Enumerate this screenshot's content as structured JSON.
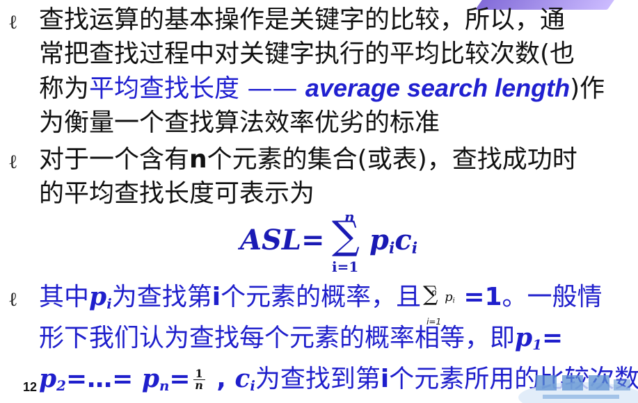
{
  "bullet_glyph": "ℓ",
  "bullet1": {
    "line1": "查找运算的基本操作是关键字的比较，所以，通",
    "line2": "常把查找过程中对关键字执行的平均比较次数(也",
    "line3_prefix": "称为",
    "line3_term_cn": "平均查找长度 —— ",
    "line3_term_en": "average search length",
    "line3_suffix": ")作",
    "line4": "为衡量一个查找算法效率优劣的标准"
  },
  "bullet2": {
    "line1_a": "对于一个含有",
    "line1_n": "n",
    "line1_b": "个元素的集合(或表)，查找成功时",
    "line2": "的平均查找长度可表示为"
  },
  "formula": {
    "lhs": "ASL",
    "equals": "=",
    "sum_symbol": "∑",
    "upper": "n",
    "lower": "i=1",
    "term_p": "p",
    "term_c": "c",
    "subscript": "i"
  },
  "bullet3": {
    "line1_a": "其中",
    "p": "p",
    "i": "i",
    "line1_b": "为查找第",
    "line1_c": "个元素的概率，且",
    "sum_symbol": "∑",
    "sum_upper": "n",
    "sum_lower": "i=1",
    "sum_term": "p",
    "sum_sub": "i",
    "equals_one": " =1",
    "line1_d": "。一般情",
    "line2_a": "形下我们认为查找每个元素的概率相等，即",
    "p1": "p",
    "one": "1",
    "eq": "=",
    "p2": "p",
    "two": "2",
    "ellipsis": "=…= ",
    "pn": "p",
    "n": "n",
    "eq2": "=",
    "frac_num": "1",
    "frac_den": "n",
    "comma": " , ",
    "c": "c",
    "line3_b": "为查找到第",
    "line3_c": "个元素所用的比较次数"
  },
  "page_number": "12",
  "colors": {
    "blue_text": "#1f1fcc",
    "formula": "#1a1ab4",
    "accent_purple": "#7b63d6"
  }
}
